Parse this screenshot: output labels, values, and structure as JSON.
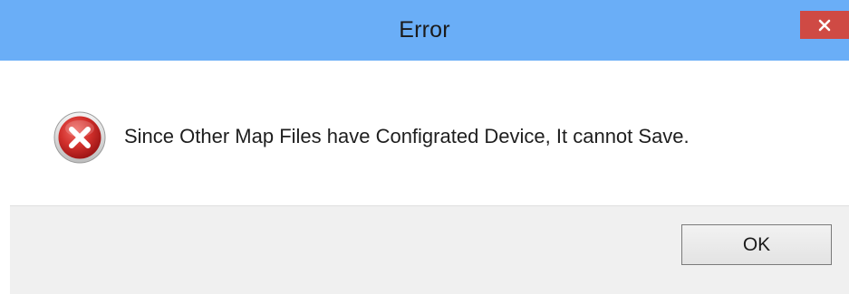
{
  "dialog": {
    "title": "Error",
    "message": "Since Other Map Files have Configrated Device, It cannot Save.",
    "ok_label": "OK",
    "icon": "error-icon",
    "close_icon": "close-icon"
  },
  "colors": {
    "titlebar": "#6aaef7",
    "close_button": "#cf4a44",
    "footer": "#f0f0f0",
    "error_red": "#c8262a"
  }
}
